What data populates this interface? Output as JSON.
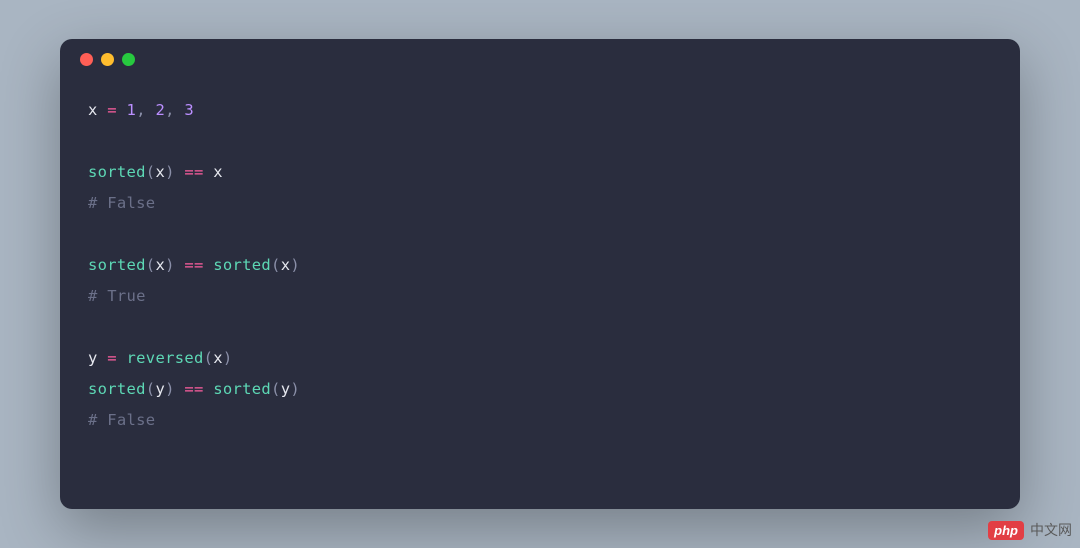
{
  "code": {
    "lines": [
      {
        "type": "code",
        "tokens": [
          {
            "cls": "tk-var",
            "t": "x "
          },
          {
            "cls": "tk-op",
            "t": "="
          },
          {
            "cls": "tk-var",
            "t": " "
          },
          {
            "cls": "tk-num",
            "t": "1"
          },
          {
            "cls": "tk-punc",
            "t": ", "
          },
          {
            "cls": "tk-num",
            "t": "2"
          },
          {
            "cls": "tk-punc",
            "t": ", "
          },
          {
            "cls": "tk-num",
            "t": "3"
          }
        ]
      },
      {
        "type": "blank"
      },
      {
        "type": "code",
        "tokens": [
          {
            "cls": "tk-func",
            "t": "sorted"
          },
          {
            "cls": "tk-punc",
            "t": "("
          },
          {
            "cls": "tk-var",
            "t": "x"
          },
          {
            "cls": "tk-punc",
            "t": ") "
          },
          {
            "cls": "tk-op",
            "t": "=="
          },
          {
            "cls": "tk-var",
            "t": " x"
          }
        ]
      },
      {
        "type": "code",
        "tokens": [
          {
            "cls": "tk-comment",
            "t": "# False"
          }
        ]
      },
      {
        "type": "blank"
      },
      {
        "type": "code",
        "tokens": [
          {
            "cls": "tk-func",
            "t": "sorted"
          },
          {
            "cls": "tk-punc",
            "t": "("
          },
          {
            "cls": "tk-var",
            "t": "x"
          },
          {
            "cls": "tk-punc",
            "t": ") "
          },
          {
            "cls": "tk-op",
            "t": "=="
          },
          {
            "cls": "tk-var",
            "t": " "
          },
          {
            "cls": "tk-func",
            "t": "sorted"
          },
          {
            "cls": "tk-punc",
            "t": "("
          },
          {
            "cls": "tk-var",
            "t": "x"
          },
          {
            "cls": "tk-punc",
            "t": ")"
          }
        ]
      },
      {
        "type": "code",
        "tokens": [
          {
            "cls": "tk-comment",
            "t": "# True"
          }
        ]
      },
      {
        "type": "blank"
      },
      {
        "type": "code",
        "tokens": [
          {
            "cls": "tk-var",
            "t": "y "
          },
          {
            "cls": "tk-op",
            "t": "="
          },
          {
            "cls": "tk-var",
            "t": " "
          },
          {
            "cls": "tk-func",
            "t": "reversed"
          },
          {
            "cls": "tk-punc",
            "t": "("
          },
          {
            "cls": "tk-var",
            "t": "x"
          },
          {
            "cls": "tk-punc",
            "t": ")"
          }
        ]
      },
      {
        "type": "code",
        "tokens": [
          {
            "cls": "tk-func",
            "t": "sorted"
          },
          {
            "cls": "tk-punc",
            "t": "("
          },
          {
            "cls": "tk-var",
            "t": "y"
          },
          {
            "cls": "tk-punc",
            "t": ") "
          },
          {
            "cls": "tk-op",
            "t": "=="
          },
          {
            "cls": "tk-var",
            "t": " "
          },
          {
            "cls": "tk-func",
            "t": "sorted"
          },
          {
            "cls": "tk-punc",
            "t": "("
          },
          {
            "cls": "tk-var",
            "t": "y"
          },
          {
            "cls": "tk-punc",
            "t": ")"
          }
        ]
      },
      {
        "type": "code",
        "tokens": [
          {
            "cls": "tk-comment",
            "t": "# False"
          }
        ]
      }
    ]
  },
  "watermark": {
    "badge": "php",
    "text": "中文网"
  }
}
